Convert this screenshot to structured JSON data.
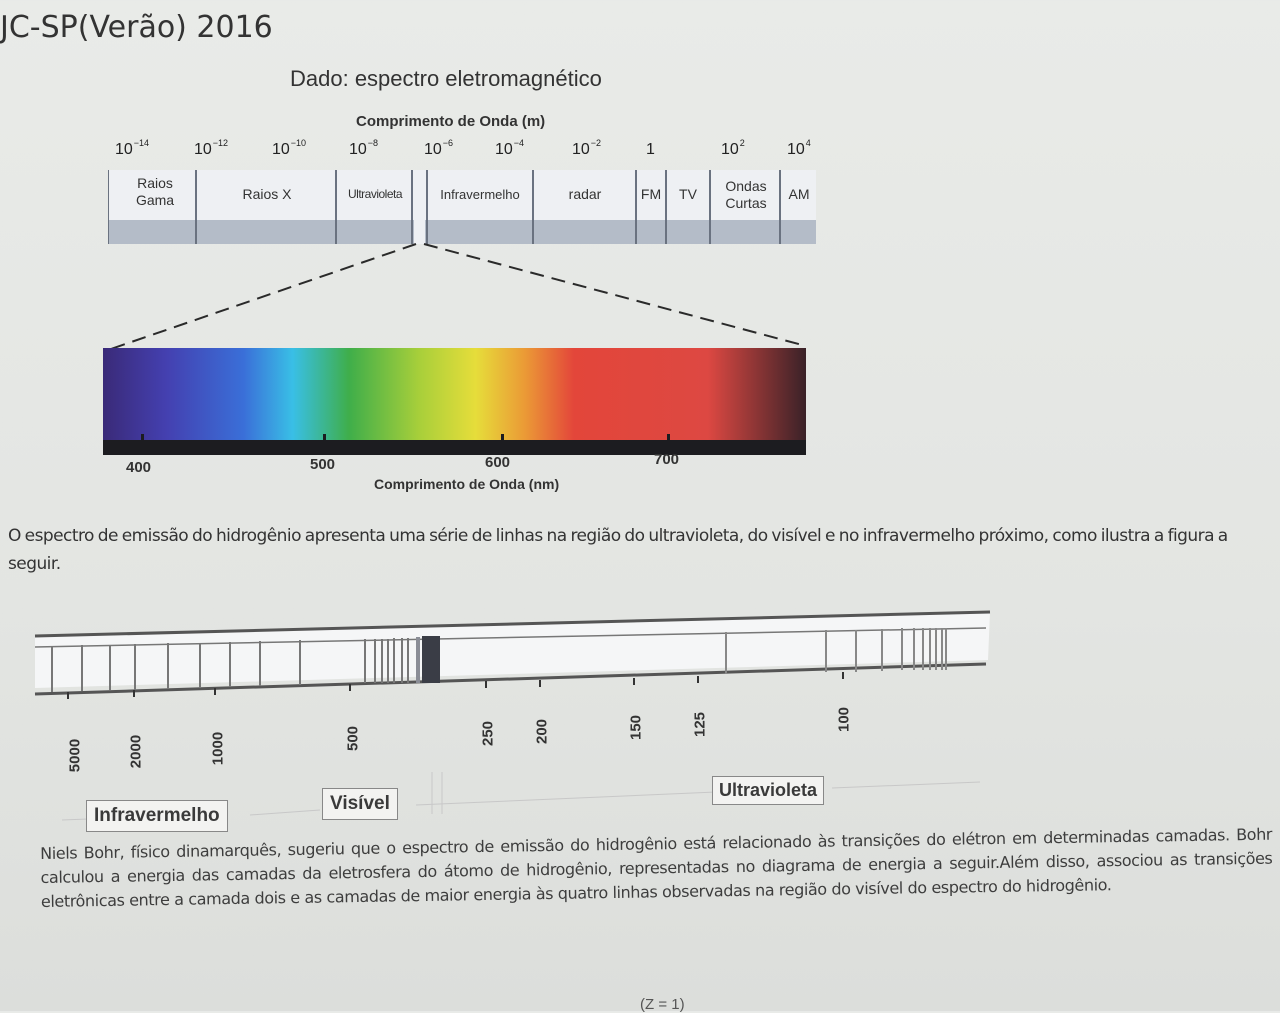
{
  "title": "JC-SP(Verão) 2016",
  "figure1": {
    "heading": "Dado: espectro eletromagnético",
    "wavelength_m_label": "Comprimento de Onda (m)",
    "exponents": [
      {
        "base": "10",
        "exp": "−14"
      },
      {
        "base": "10",
        "exp": "−12"
      },
      {
        "base": "10",
        "exp": "−10"
      },
      {
        "base": "10",
        "exp": "−8"
      },
      {
        "base": "10",
        "exp": "−6"
      },
      {
        "base": "10",
        "exp": "−4"
      },
      {
        "base": "10",
        "exp": "−2"
      },
      {
        "base": "1",
        "exp": ""
      },
      {
        "base": "10",
        "exp": "2"
      },
      {
        "base": "10",
        "exp": "4"
      }
    ],
    "bands": {
      "gamma_l1": "Raios",
      "gamma_l2": "Gama",
      "xray": "Raios X",
      "uv": "Ultravioleta",
      "ir": "Infravermelho",
      "radar": "radar",
      "fm": "FM",
      "tv": "TV",
      "short_l1": "Ondas",
      "short_l2": "Curtas",
      "am": "AM"
    },
    "nm_ticks": [
      "400",
      "500",
      "600",
      "700"
    ],
    "wavelength_nm_label": "Comprimento de Onda (nm)"
  },
  "intro_text": "O espectro de emissão do hidrogênio apresenta uma série de linhas na região do ultravioleta, do visível e no infravermelho próximo, como ilustra a figura a seguir.",
  "figure2": {
    "ticks": [
      "5000",
      "2000",
      "1000",
      "500",
      "250",
      "200",
      "150",
      "125",
      "100"
    ],
    "regions": {
      "ir": "Infravermelho",
      "vis": "Visível",
      "uv": "Ultravioleta"
    }
  },
  "bohr_text": "Niels Bohr, físico dinamarquês, sugeriu que o espectro de emissão do hidrogênio está relacionado às transições do elétron em determinadas camadas. Bohr calculou a energia das camadas da eletrosfera do átomo de hidrogênio, representadas no diagrama de energia a seguir.Além disso, associou as transições eletrônicas entre a camada dois e as camadas de maior energia às quatro linhas observadas na região do visível do espectro do hidrogênio.",
  "cut_text": "(Z = 1)",
  "colors": {
    "bar_fill": "#eef0f3",
    "bar_strip": "#b4bcc8",
    "spectrum": [
      "#3a2a78",
      "#3a6fd8",
      "#39bfe6",
      "#3fae4a",
      "#d8d838",
      "#e3463a",
      "#3a2228"
    ]
  }
}
